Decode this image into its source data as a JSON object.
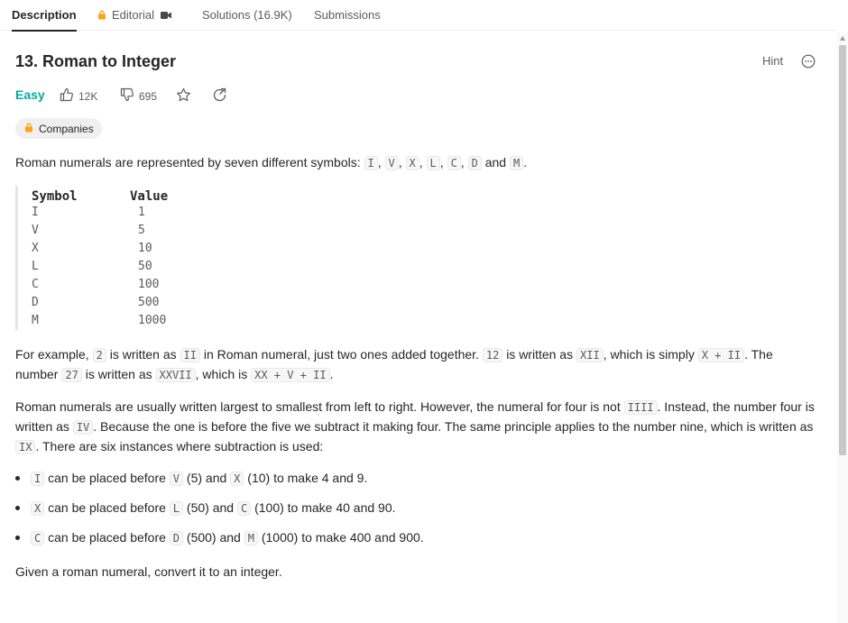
{
  "tabs": {
    "description": "Description",
    "editorial": "Editorial",
    "solutions": "Solutions (16.9K)",
    "submissions": "Submissions"
  },
  "problem": {
    "title": "13. Roman to Integer",
    "hint": "Hint",
    "difficulty": "Easy",
    "likes": "12K",
    "dislikes": "695",
    "companies": "Companies"
  },
  "colors": {
    "easy": "#00af9b",
    "lock": "#ffa116"
  },
  "icons": [
    "lock-icon",
    "video-icon",
    "more-icon",
    "thumbs-up-icon",
    "thumbs-down-icon",
    "star-icon",
    "share-icon"
  ],
  "intro": {
    "text": "Roman numerals are represented by seven different symbols:",
    "symbols": [
      "I",
      "V",
      "X",
      "L",
      "C",
      "D",
      "M"
    ],
    "sep": ",",
    "and": "and",
    "end": "."
  },
  "table": {
    "header_symbol": "Symbol",
    "header_value": "Value",
    "rows": [
      {
        "symbol": "I",
        "value": "1"
      },
      {
        "symbol": "V",
        "value": "5"
      },
      {
        "symbol": "X",
        "value": "10"
      },
      {
        "symbol": "L",
        "value": "50"
      },
      {
        "symbol": "C",
        "value": "100"
      },
      {
        "symbol": "D",
        "value": "500"
      },
      {
        "symbol": "M",
        "value": "1000"
      }
    ]
  },
  "example": {
    "t1": "For example,",
    "c1": "2",
    "t2": "is written as",
    "c2": "II",
    "t3": "in Roman numeral, just two ones added together.",
    "c3": "12",
    "t4": "is written as",
    "c4": "XII",
    "t5": ", which is simply",
    "c5": "X + II",
    "t6": ". The number",
    "c6": "27",
    "t7": "is written as",
    "c7": "XXVII",
    "t8": ", which is",
    "c8": "XX + V + II",
    "t9": "."
  },
  "subtraction": {
    "t1": "Roman numerals are usually written largest to smallest from left to right. However, the numeral for four is not",
    "c1": "IIII",
    "t2": ". Instead, the number four is written as",
    "c2": "IV",
    "t3": ". Because the one is before the five we subtract it making four. The same principle applies to the number nine, which is written as",
    "c3": "IX",
    "t4": ". There are six instances where subtraction is used:"
  },
  "bullets": [
    {
      "a": "I",
      "t1": "can be placed before",
      "b": "V",
      "t2": "(5) and",
      "c": "X",
      "t3": "(10) to make 4 and 9."
    },
    {
      "a": "X",
      "t1": "can be placed before",
      "b": "L",
      "t2": "(50) and",
      "c": "C",
      "t3": "(100) to make 40 and 90."
    },
    {
      "a": "C",
      "t1": "can be placed before",
      "b": "D",
      "t2": "(500) and",
      "c": "M",
      "t3": "(1000) to make 400 and 900."
    }
  ],
  "conclusion": "Given a roman numeral, convert it to an integer."
}
